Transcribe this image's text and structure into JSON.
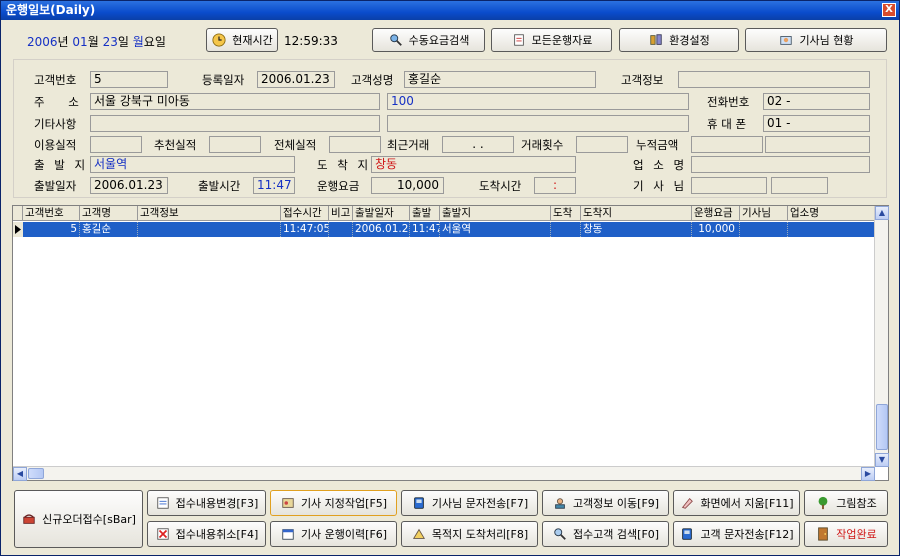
{
  "window": {
    "title": "운행일보(Daily)",
    "close_label": "X"
  },
  "datebar": {
    "year": "2006",
    "year_unit": "년",
    "month": "01",
    "month_unit": "월",
    "day": "23",
    "day_unit": "일",
    "weekday": "월",
    "weekday_unit": "요일"
  },
  "clock": {
    "button_label": "현재시간",
    "time": "12:59:33"
  },
  "toolbar": [
    {
      "label": "수동요금검색",
      "icon": "search-people-icon"
    },
    {
      "label": "모든운행자료",
      "icon": "document-icon"
    },
    {
      "label": "환경설정",
      "icon": "tools-icon"
    },
    {
      "label": "기사님 현황",
      "icon": "driver-icon"
    }
  ],
  "form": {
    "customer_no_label": "고객번호",
    "customer_no": "5",
    "reg_date_label": "등록일자",
    "reg_date": "2006.01.23",
    "customer_name_label": "고객성명",
    "customer_name": "홍길순",
    "customer_info_label": "고객정보",
    "customer_info": "",
    "address_label": "주 소",
    "address": "서울 강북구 미아동",
    "address_detail": "100",
    "phone_label": "전화번호",
    "phone": "02 -",
    "mobile_label": "휴 대 폰",
    "mobile": "01 -",
    "other_label": "기타사항",
    "usage_label": "이용실적",
    "recommend_label": "추천실적",
    "total_label": "전체실적",
    "recent_label": "최근거래",
    "recent_value": ". .",
    "count_label": "거래횟수",
    "accum_label": "누적금액",
    "origin_label": "출 발 지",
    "origin": "서울역",
    "dest_label": "도 착 지",
    "dest": "창동",
    "business_label": "업 소 명",
    "depart_date_label": "출발일자",
    "depart_date": "2006.01.23",
    "depart_time_label": "출발시간",
    "depart_time": "11:47",
    "fare_label": "운행요금",
    "fare": "10,000",
    "arrive_time_label": "도착시간",
    "arrive_time": ":",
    "driver_label": "기 사 님"
  },
  "grid": {
    "columns": [
      "고객번호",
      "고객명",
      "고객정보",
      "접수시간",
      "비고",
      "출발일자",
      "출발",
      "출발지",
      "도착",
      "도착지",
      "운행요금",
      "기사님",
      "업소명"
    ],
    "rows": [
      [
        "5",
        "홍길순",
        "",
        "11:47:05",
        "",
        "2006.01.23",
        "11:47",
        "서울역",
        "",
        "창동",
        "10,000",
        "",
        ""
      ]
    ]
  },
  "bottom": {
    "new_order": "신규오더접수[sBar]",
    "buttons": [
      {
        "label": "접수내용변경[F3]",
        "icon": "edit-icon"
      },
      {
        "label": "기사 지정작업[F5]",
        "icon": "assign-driver-icon"
      },
      {
        "label": "기사님 문자전송[F7]",
        "icon": "sms-icon"
      },
      {
        "label": "고객정보 이동[F9]",
        "icon": "customer-move-icon"
      },
      {
        "label": "화면에서 지움[F11]",
        "icon": "erase-icon"
      },
      {
        "label": "그림참조",
        "icon": "tree-icon"
      },
      {
        "label": "접수내용취소[F4]",
        "icon": "cancel-icon"
      },
      {
        "label": "기사 운행이력[F6]",
        "icon": "calendar-icon"
      },
      {
        "label": "목적지 도착처리[F8]",
        "icon": "arrive-icon"
      },
      {
        "label": "접수고객 검색[F0]",
        "icon": "search-customer-icon"
      },
      {
        "label": "고객 문자전송[F12]",
        "icon": "sms-icon"
      },
      {
        "label": "작업완료",
        "icon": "door-exit-icon"
      }
    ]
  },
  "colors": {
    "title_bar": "#0a4ccc",
    "selected_row": "#1f5fc7",
    "blue_text": "#1530c4",
    "red_text": "#d01818"
  }
}
